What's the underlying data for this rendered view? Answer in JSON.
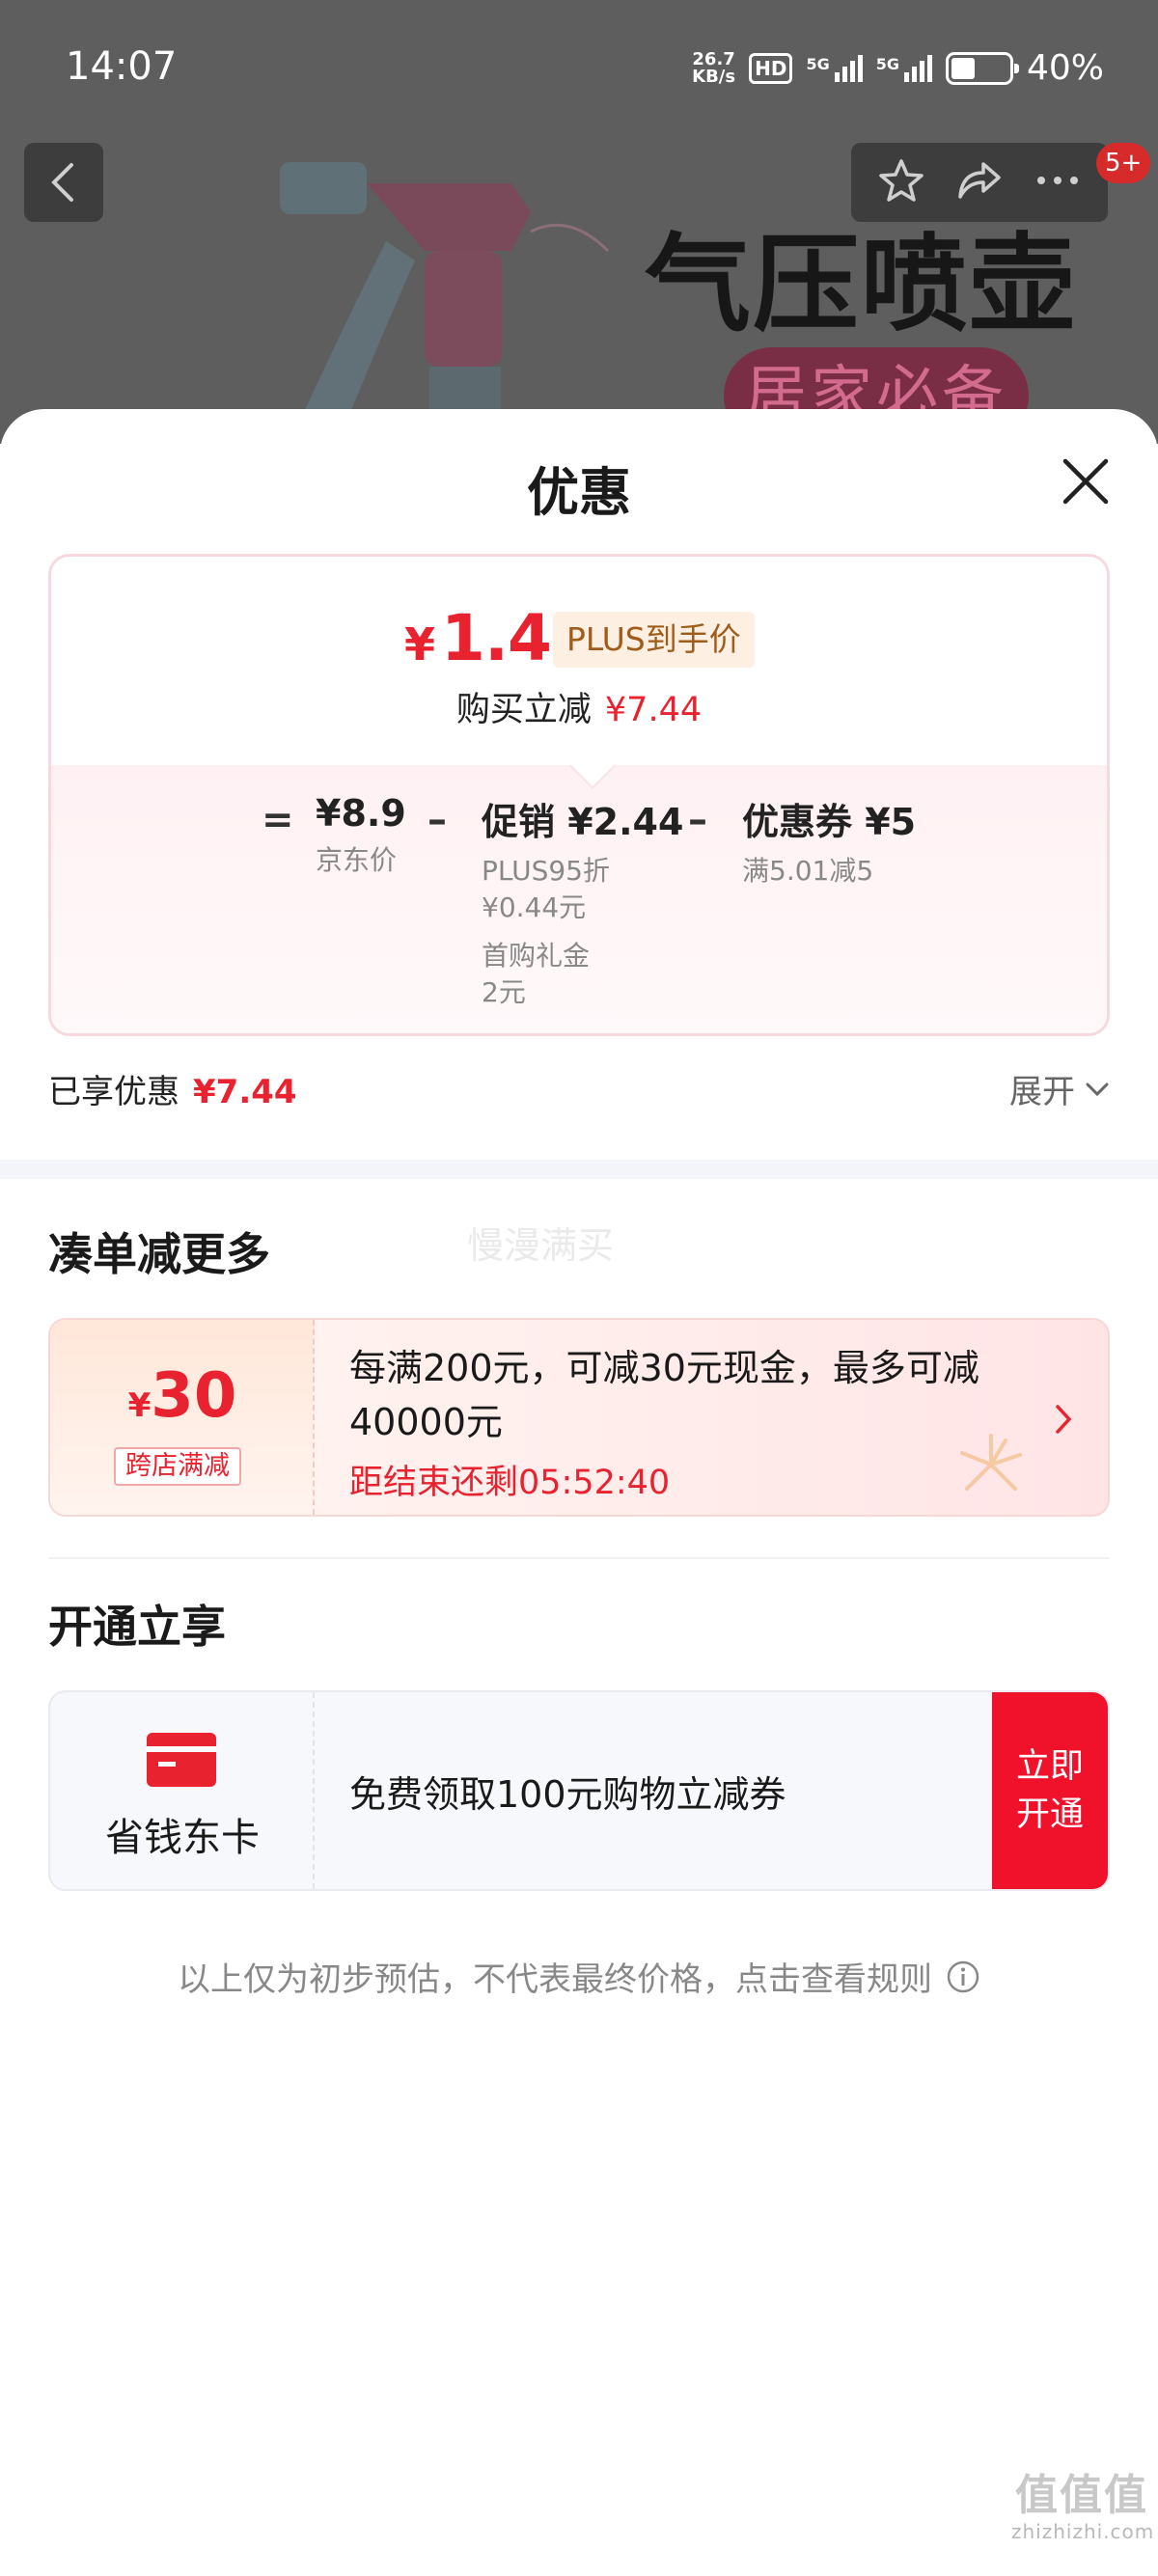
{
  "status_bar": {
    "time": "14:07",
    "net_speed_value": "26.7",
    "net_speed_unit": "KB/s",
    "hd_label": "HD",
    "signal1_label": "5G",
    "signal2_label": "5G",
    "battery": "40%"
  },
  "background": {
    "product_title": "气压喷壶",
    "product_subtitle": "居家必备",
    "notification_badge": "5+"
  },
  "sheet": {
    "title": "优惠",
    "final_price": {
      "currency": "¥",
      "amount": "1.46",
      "tag": "PLUS到手价",
      "instant_label": "购买立减",
      "instant_value": "¥7.44"
    },
    "breakdown": {
      "equals": "=",
      "minus": "–",
      "jd_price": "¥8.9",
      "jd_price_label": "京东价",
      "promo_title": "促销 ¥2.44",
      "promo_line1": "PLUS95折",
      "promo_line2": "¥0.44元",
      "promo_line3": "首购礼金",
      "promo_line4": "2元",
      "coupon_title": "优惠券 ¥5",
      "coupon_sub": "满5.01减5"
    },
    "enjoyed": {
      "label": "已享优惠",
      "value": "¥7.44",
      "expand_label": "展开"
    },
    "combine_section": {
      "title": "凑单减更多",
      "watermark": "慢漫满买",
      "promo": {
        "currency": "¥",
        "amount": "30",
        "tag": "跨店满减",
        "text": "每满200元，可减30元现金，最多可减40000元",
        "countdown": "距结束还剩05:52:40"
      }
    },
    "membership_section": {
      "title": "开通立享",
      "card_name": "省钱东卡",
      "offer_text": "免费领取100元购物立减券",
      "button_label": "立即开通"
    },
    "disclaimer": "以上仅为初步预估，不代表最终价格，点击查看规则"
  },
  "watermark_site": {
    "logo": "值值值",
    "url": "zhizhizhi.com"
  },
  "colors": {
    "accent_red": "#e8232f",
    "plus_tag_bg": "#fdf0e2",
    "plus_tag_text": "#a05c1b",
    "dim_overlay": "#5e5e5e"
  },
  "icons": [
    "back-arrow-icon",
    "star-icon",
    "share-icon",
    "more-icon",
    "close-icon",
    "chevron-down-icon",
    "chevron-right-icon",
    "info-icon",
    "card-icon"
  ]
}
